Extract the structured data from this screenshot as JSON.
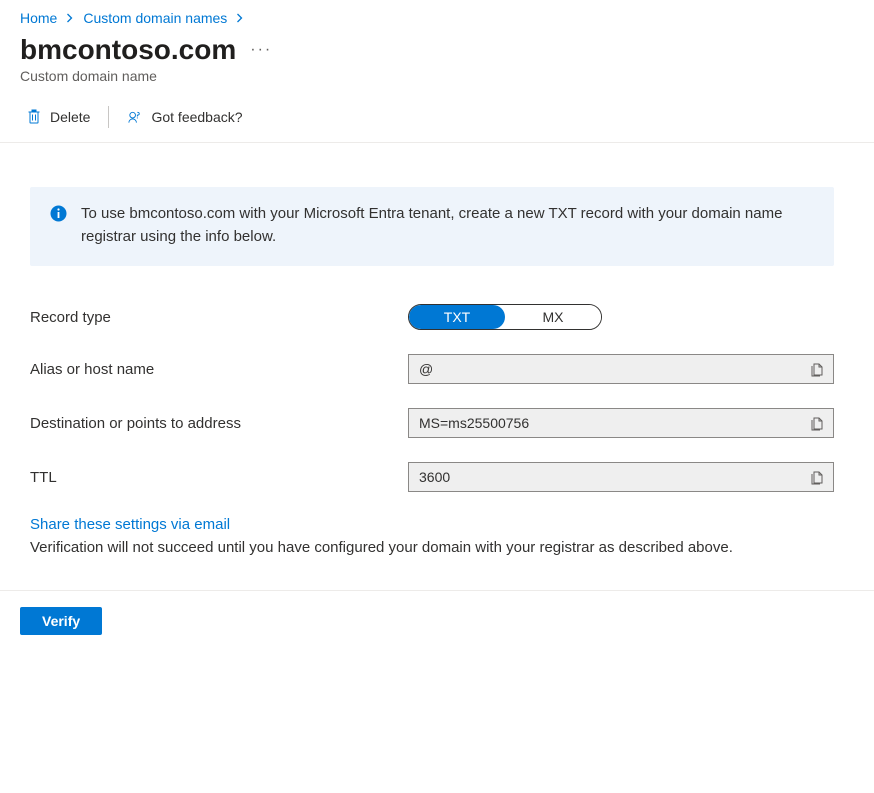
{
  "breadcrumb": {
    "home": "Home",
    "custom_domains": "Custom domain names"
  },
  "header": {
    "title": "bmcontoso.com",
    "subtitle": "Custom domain name"
  },
  "commands": {
    "delete": "Delete",
    "feedback": "Got feedback?"
  },
  "banner": {
    "text": "To use bmcontoso.com with your Microsoft Entra tenant, create a new TXT record with your domain name registrar using the info below."
  },
  "fields": {
    "record_type": {
      "label": "Record type",
      "opt_txt": "TXT",
      "opt_mx": "MX"
    },
    "alias": {
      "label": "Alias or host name",
      "value": "@"
    },
    "destination": {
      "label": "Destination or points to address",
      "value": "MS=ms25500756"
    },
    "ttl": {
      "label": "TTL",
      "value": "3600"
    }
  },
  "share": {
    "link": "Share these settings via email",
    "help": "Verification will not succeed until you have configured your domain with your registrar as described above."
  },
  "footer": {
    "verify": "Verify"
  }
}
